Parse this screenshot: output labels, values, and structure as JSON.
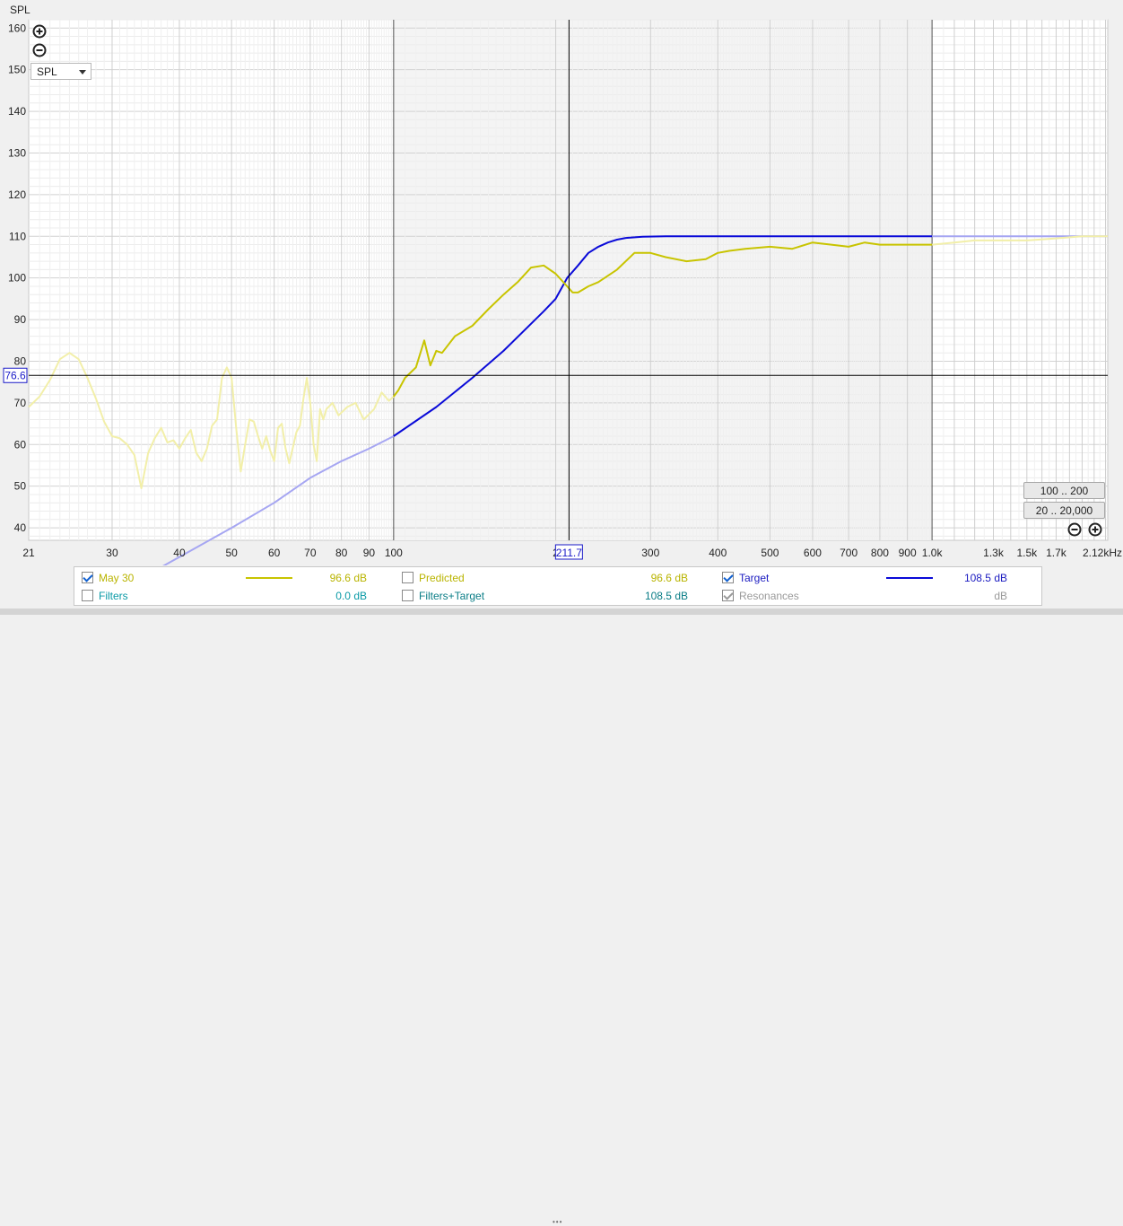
{
  "yaxis_title": "SPL",
  "dropdown_value": "SPL",
  "cursor": {
    "x_readout": "211.7",
    "y_readout": "76.6",
    "x_value": 211.7,
    "y_value": 76.6
  },
  "buttons": {
    "range_100_200": "100 .. 200",
    "range_20_20000": "20 .. 20,000"
  },
  "colors": {
    "measurement": "#c8c400",
    "measurement_faded": "#f2efa9",
    "target": "#0a0ad8",
    "target_faded": "#a6a6f2",
    "cursor": "#000000",
    "cursor_box": "#1a1ac8"
  },
  "chart_data": {
    "type": "line",
    "xscale": "log",
    "xlim": [
      21,
      2120
    ],
    "ylim": [
      37,
      162
    ],
    "ylabel": "SPL",
    "xunit": "kHz",
    "x_ticks": [
      {
        "v": 21,
        "label": "21"
      },
      {
        "v": 30,
        "label": "30"
      },
      {
        "v": 40,
        "label": "40"
      },
      {
        "v": 50,
        "label": "50"
      },
      {
        "v": 60,
        "label": "60"
      },
      {
        "v": 70,
        "label": "70"
      },
      {
        "v": 80,
        "label": "80"
      },
      {
        "v": 90,
        "label": "90"
      },
      {
        "v": 100,
        "label": "100"
      },
      {
        "v": 200,
        "label": "2"
      },
      {
        "v": 300,
        "label": "300"
      },
      {
        "v": 400,
        "label": "400"
      },
      {
        "v": 500,
        "label": "500"
      },
      {
        "v": 600,
        "label": "600"
      },
      {
        "v": 700,
        "label": "700"
      },
      {
        "v": 800,
        "label": "800"
      },
      {
        "v": 900,
        "label": "900"
      },
      {
        "v": 1000,
        "label": "1.0k"
      },
      {
        "v": 1300,
        "label": "1.3k"
      },
      {
        "v": 1500,
        "label": "1.5k"
      },
      {
        "v": 1700,
        "label": "1.7k"
      },
      {
        "v": 2120,
        "label": "2.12kHz"
      }
    ],
    "y_ticks": [
      40,
      50,
      60,
      70,
      80,
      90,
      100,
      110,
      120,
      130,
      140,
      150,
      160
    ],
    "focus_range": [
      100,
      1000
    ],
    "series": [
      {
        "name": "May 30",
        "points": [
          [
            21,
            69
          ],
          [
            22,
            71.5
          ],
          [
            23,
            75.5
          ],
          [
            24,
            80.5
          ],
          [
            25,
            82
          ],
          [
            26,
            80.5
          ],
          [
            27,
            76
          ],
          [
            28,
            71
          ],
          [
            29,
            65.5
          ],
          [
            30,
            62
          ],
          [
            31,
            61.5
          ],
          [
            32,
            60
          ],
          [
            33,
            57.5
          ],
          [
            34,
            49.5
          ],
          [
            35,
            58
          ],
          [
            36,
            61.5
          ],
          [
            37,
            64
          ],
          [
            38,
            60.5
          ],
          [
            39,
            61
          ],
          [
            40,
            59
          ],
          [
            41,
            61.5
          ],
          [
            42,
            63.5
          ],
          [
            43,
            58
          ],
          [
            44,
            56
          ],
          [
            45,
            59
          ],
          [
            46,
            64.5
          ],
          [
            47,
            66
          ],
          [
            48,
            76
          ],
          [
            49,
            78.5
          ],
          [
            50,
            76
          ],
          [
            51,
            64
          ],
          [
            52,
            53.5
          ],
          [
            53,
            60
          ],
          [
            54,
            66
          ],
          [
            55,
            65.5
          ],
          [
            56,
            62
          ],
          [
            57,
            59
          ],
          [
            58,
            62
          ],
          [
            59,
            58.5
          ],
          [
            60,
            56
          ],
          [
            61,
            64
          ],
          [
            62,
            65
          ],
          [
            63,
            59
          ],
          [
            64,
            55.5
          ],
          [
            66,
            63
          ],
          [
            67,
            64.5
          ],
          [
            68,
            71
          ],
          [
            69,
            76
          ],
          [
            70,
            70
          ],
          [
            71,
            60
          ],
          [
            72,
            56
          ],
          [
            73,
            68.5
          ],
          [
            74,
            66
          ],
          [
            75,
            68.5
          ],
          [
            77,
            70
          ],
          [
            79,
            67
          ],
          [
            82,
            69
          ],
          [
            85,
            70
          ],
          [
            88,
            66
          ],
          [
            92,
            68.5
          ],
          [
            95,
            72.5
          ],
          [
            98,
            70.5
          ],
          [
            100,
            71.5
          ],
          [
            102,
            73
          ],
          [
            105,
            76
          ],
          [
            110,
            78.5
          ],
          [
            114,
            85
          ],
          [
            117,
            79
          ],
          [
            120,
            82.5
          ],
          [
            123,
            82
          ],
          [
            130,
            86
          ],
          [
            140,
            88.5
          ],
          [
            150,
            92.5
          ],
          [
            160,
            96
          ],
          [
            170,
            99
          ],
          [
            180,
            102.5
          ],
          [
            190,
            103
          ],
          [
            200,
            101
          ],
          [
            210,
            98
          ],
          [
            215,
            96.5
          ],
          [
            220,
            96.5
          ],
          [
            230,
            98
          ],
          [
            240,
            99
          ],
          [
            260,
            102
          ],
          [
            280,
            106
          ],
          [
            300,
            106
          ],
          [
            320,
            105
          ],
          [
            350,
            104
          ],
          [
            380,
            104.5
          ],
          [
            400,
            106
          ],
          [
            420,
            106.5
          ],
          [
            450,
            107
          ],
          [
            500,
            107.5
          ],
          [
            550,
            107
          ],
          [
            600,
            108.5
          ],
          [
            650,
            108
          ],
          [
            700,
            107.5
          ],
          [
            750,
            108.5
          ],
          [
            800,
            108
          ],
          [
            900,
            108
          ],
          [
            1000,
            108
          ],
          [
            1100,
            108.5
          ],
          [
            1200,
            109
          ],
          [
            1300,
            109
          ],
          [
            1500,
            109
          ],
          [
            1700,
            109.5
          ],
          [
            1900,
            110
          ],
          [
            2120,
            110
          ]
        ]
      },
      {
        "name": "Target",
        "points": [
          [
            21,
            14
          ],
          [
            30,
            24
          ],
          [
            40,
            33
          ],
          [
            50,
            40
          ],
          [
            60,
            46
          ],
          [
            70,
            52
          ],
          [
            80,
            56
          ],
          [
            90,
            59
          ],
          [
            100,
            62
          ],
          [
            120,
            69
          ],
          [
            140,
            76
          ],
          [
            160,
            82.5
          ],
          [
            180,
            89
          ],
          [
            190,
            92
          ],
          [
            200,
            95
          ],
          [
            210,
            100
          ],
          [
            220,
            103
          ],
          [
            230,
            106
          ],
          [
            240,
            107.5
          ],
          [
            250,
            108.5
          ],
          [
            260,
            109.2
          ],
          [
            270,
            109.6
          ],
          [
            290,
            109.9
          ],
          [
            320,
            110
          ],
          [
            400,
            110
          ],
          [
            1000,
            110
          ],
          [
            2120,
            110
          ]
        ]
      }
    ]
  },
  "legend": {
    "row1": [
      {
        "label": "May 30",
        "value": "96.6 dB",
        "checked": true
      },
      {
        "label": "Predicted",
        "value": "96.6 dB",
        "checked": false
      },
      {
        "label": "Target",
        "value": "108.5 dB",
        "checked": true
      }
    ],
    "row2": [
      {
        "label": "Filters",
        "value": "0.0 dB",
        "checked": false
      },
      {
        "label": "Filters+Target",
        "value": "108.5 dB",
        "checked": false
      },
      {
        "label": "Resonances",
        "value": "dB",
        "checked": true
      }
    ]
  }
}
